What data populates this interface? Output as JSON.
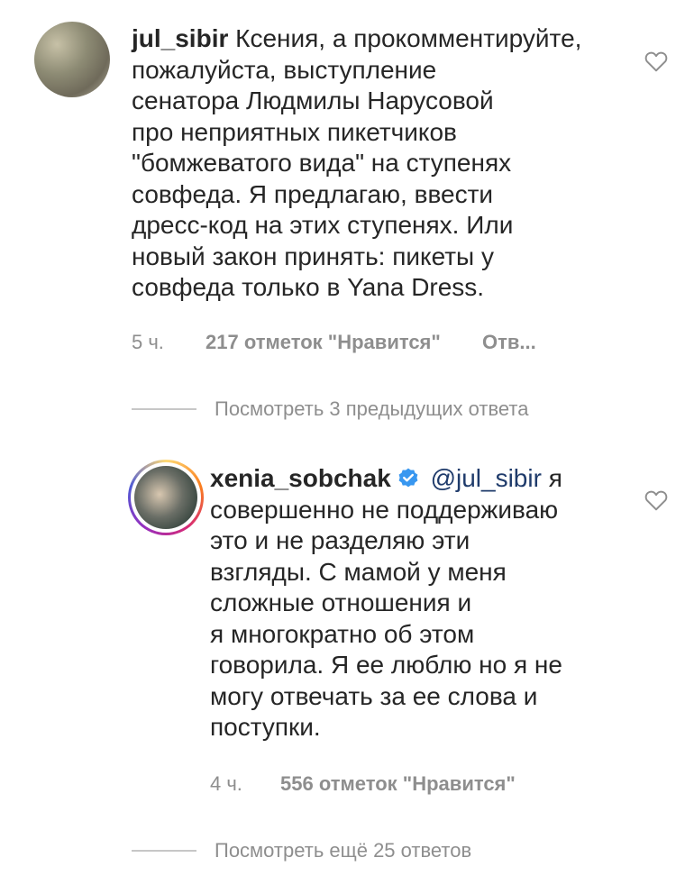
{
  "comment1": {
    "username": "jul_sibir",
    "text_lines": [
      "Ксения, а прокомментируйте,",
      "пожалуйста, выступление",
      "сенатора Людмилы Нарусовой",
      "про неприятных  пикетчиков",
      "\"бомжеватого вида\" на ступенях",
      "совфеда. Я предлагаю, ввести",
      "дресс-код на этих ступенях.  Или",
      "новый закон принять: пикеты у",
      "совфеда только в Yana Dress."
    ],
    "time": "5 ч.",
    "likes": "217 отметок \"Нравится\"",
    "reply": "Отв..."
  },
  "view_previous": "Посмотреть 3 предыдущих ответа",
  "comment2": {
    "username": "xenia_sobchak",
    "mention": "@jul_sibir",
    "first_word": "я",
    "text_lines": [
      "совершенно не поддерживаю",
      "это и не разделяю эти",
      "взгляды. С мамой у меня",
      "сложные отношения и",
      "я многократно об этом",
      "говорила. Я ее люблю но я не",
      "могу отвечать за ее слова и",
      "поступки."
    ],
    "time": "4 ч.",
    "likes": "556 отметок \"Нравится\""
  },
  "view_more": "Посмотреть ещё 25 ответов",
  "icons": {
    "heart": "heart-icon",
    "verified": "verified-badge-icon"
  },
  "colors": {
    "verified": "#3897f0",
    "meta": "#8e8e8e",
    "mention": "#1f3b6b"
  }
}
